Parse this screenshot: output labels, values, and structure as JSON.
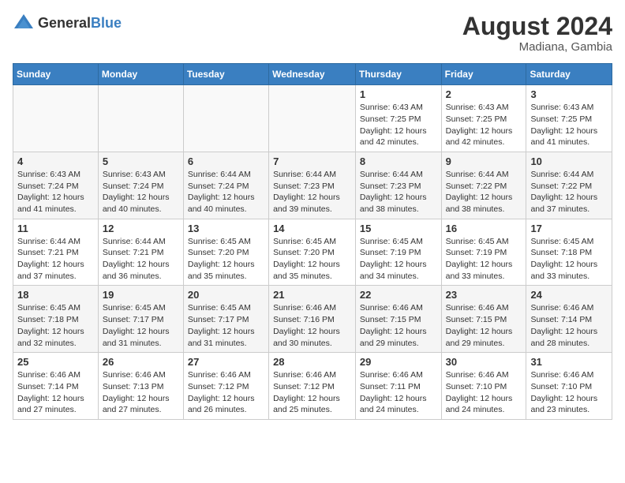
{
  "logo": {
    "text_general": "General",
    "text_blue": "Blue"
  },
  "title": {
    "month_year": "August 2024",
    "location": "Madiana, Gambia"
  },
  "calendar": {
    "days_of_week": [
      "Sunday",
      "Monday",
      "Tuesday",
      "Wednesday",
      "Thursday",
      "Friday",
      "Saturday"
    ],
    "weeks": [
      [
        {
          "day": "",
          "info": ""
        },
        {
          "day": "",
          "info": ""
        },
        {
          "day": "",
          "info": ""
        },
        {
          "day": "",
          "info": ""
        },
        {
          "day": "1",
          "info": "Sunrise: 6:43 AM\nSunset: 7:25 PM\nDaylight: 12 hours\nand 42 minutes."
        },
        {
          "day": "2",
          "info": "Sunrise: 6:43 AM\nSunset: 7:25 PM\nDaylight: 12 hours\nand 42 minutes."
        },
        {
          "day": "3",
          "info": "Sunrise: 6:43 AM\nSunset: 7:25 PM\nDaylight: 12 hours\nand 41 minutes."
        }
      ],
      [
        {
          "day": "4",
          "info": "Sunrise: 6:43 AM\nSunset: 7:24 PM\nDaylight: 12 hours\nand 41 minutes."
        },
        {
          "day": "5",
          "info": "Sunrise: 6:43 AM\nSunset: 7:24 PM\nDaylight: 12 hours\nand 40 minutes."
        },
        {
          "day": "6",
          "info": "Sunrise: 6:44 AM\nSunset: 7:24 PM\nDaylight: 12 hours\nand 40 minutes."
        },
        {
          "day": "7",
          "info": "Sunrise: 6:44 AM\nSunset: 7:23 PM\nDaylight: 12 hours\nand 39 minutes."
        },
        {
          "day": "8",
          "info": "Sunrise: 6:44 AM\nSunset: 7:23 PM\nDaylight: 12 hours\nand 38 minutes."
        },
        {
          "day": "9",
          "info": "Sunrise: 6:44 AM\nSunset: 7:22 PM\nDaylight: 12 hours\nand 38 minutes."
        },
        {
          "day": "10",
          "info": "Sunrise: 6:44 AM\nSunset: 7:22 PM\nDaylight: 12 hours\nand 37 minutes."
        }
      ],
      [
        {
          "day": "11",
          "info": "Sunrise: 6:44 AM\nSunset: 7:21 PM\nDaylight: 12 hours\nand 37 minutes."
        },
        {
          "day": "12",
          "info": "Sunrise: 6:44 AM\nSunset: 7:21 PM\nDaylight: 12 hours\nand 36 minutes."
        },
        {
          "day": "13",
          "info": "Sunrise: 6:45 AM\nSunset: 7:20 PM\nDaylight: 12 hours\nand 35 minutes."
        },
        {
          "day": "14",
          "info": "Sunrise: 6:45 AM\nSunset: 7:20 PM\nDaylight: 12 hours\nand 35 minutes."
        },
        {
          "day": "15",
          "info": "Sunrise: 6:45 AM\nSunset: 7:19 PM\nDaylight: 12 hours\nand 34 minutes."
        },
        {
          "day": "16",
          "info": "Sunrise: 6:45 AM\nSunset: 7:19 PM\nDaylight: 12 hours\nand 33 minutes."
        },
        {
          "day": "17",
          "info": "Sunrise: 6:45 AM\nSunset: 7:18 PM\nDaylight: 12 hours\nand 33 minutes."
        }
      ],
      [
        {
          "day": "18",
          "info": "Sunrise: 6:45 AM\nSunset: 7:18 PM\nDaylight: 12 hours\nand 32 minutes."
        },
        {
          "day": "19",
          "info": "Sunrise: 6:45 AM\nSunset: 7:17 PM\nDaylight: 12 hours\nand 31 minutes."
        },
        {
          "day": "20",
          "info": "Sunrise: 6:45 AM\nSunset: 7:17 PM\nDaylight: 12 hours\nand 31 minutes."
        },
        {
          "day": "21",
          "info": "Sunrise: 6:46 AM\nSunset: 7:16 PM\nDaylight: 12 hours\nand 30 minutes."
        },
        {
          "day": "22",
          "info": "Sunrise: 6:46 AM\nSunset: 7:15 PM\nDaylight: 12 hours\nand 29 minutes."
        },
        {
          "day": "23",
          "info": "Sunrise: 6:46 AM\nSunset: 7:15 PM\nDaylight: 12 hours\nand 29 minutes."
        },
        {
          "day": "24",
          "info": "Sunrise: 6:46 AM\nSunset: 7:14 PM\nDaylight: 12 hours\nand 28 minutes."
        }
      ],
      [
        {
          "day": "25",
          "info": "Sunrise: 6:46 AM\nSunset: 7:14 PM\nDaylight: 12 hours\nand 27 minutes."
        },
        {
          "day": "26",
          "info": "Sunrise: 6:46 AM\nSunset: 7:13 PM\nDaylight: 12 hours\nand 27 minutes."
        },
        {
          "day": "27",
          "info": "Sunrise: 6:46 AM\nSunset: 7:12 PM\nDaylight: 12 hours\nand 26 minutes."
        },
        {
          "day": "28",
          "info": "Sunrise: 6:46 AM\nSunset: 7:12 PM\nDaylight: 12 hours\nand 25 minutes."
        },
        {
          "day": "29",
          "info": "Sunrise: 6:46 AM\nSunset: 7:11 PM\nDaylight: 12 hours\nand 24 minutes."
        },
        {
          "day": "30",
          "info": "Sunrise: 6:46 AM\nSunset: 7:10 PM\nDaylight: 12 hours\nand 24 minutes."
        },
        {
          "day": "31",
          "info": "Sunrise: 6:46 AM\nSunset: 7:10 PM\nDaylight: 12 hours\nand 23 minutes."
        }
      ]
    ]
  }
}
